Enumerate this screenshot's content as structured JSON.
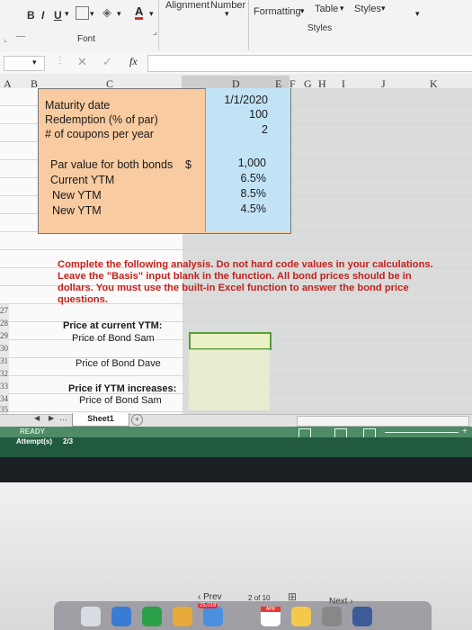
{
  "ribbon": {
    "bold": "B",
    "italic": "I",
    "underline": "U",
    "font_group": "Font",
    "alignment": "Alignment",
    "number": "Number",
    "formatting": "Formatting",
    "table": "Table",
    "styles": "Styles",
    "styles_group": "Styles",
    "fx": "fx"
  },
  "columns": [
    "A",
    "B",
    "C",
    "D",
    "E",
    "F",
    "G",
    "H",
    "I",
    "J",
    "K"
  ],
  "table": {
    "labels1": [
      "Maturity date",
      "Redemption (% of par)",
      "# of coupons per year"
    ],
    "values1": [
      "1/1/2020",
      "100",
      "2"
    ],
    "labels2": [
      "Par value for both bonds",
      "Current YTM",
      "New YTM",
      "New YTM"
    ],
    "dollar": "$",
    "values2": [
      "1,000",
      "6.5%",
      "8.5%",
      "4.5%"
    ]
  },
  "instructions": "Complete the following analysis. Do not hard code values in your calculations. Leave the \"Basis\" input blank in the function. All bond prices should be in dollars. You must use the built-in Excel function to answer the bond price questions.",
  "rows": [
    "27",
    "28",
    "29",
    "30",
    "31",
    "32",
    "33",
    "34",
    "35"
  ],
  "analysis": {
    "h1": "Price at current YTM:",
    "r1": "Price of Bond Sam",
    "r2": "Price of Bond Dave",
    "h2": "Price if YTM increases:",
    "r3": "Price of Bond Sam"
  },
  "sheet_tab": "Sheet1",
  "status": {
    "ready": "READY",
    "attempts_label": "Attempt(s)",
    "attempts_value": "2/3"
  },
  "nav": {
    "prev": "Prev",
    "page": "2",
    "of": "of",
    "total": "10",
    "next": "Next"
  },
  "dock": {
    "badge": "25,018",
    "calendar_month": "APR"
  }
}
